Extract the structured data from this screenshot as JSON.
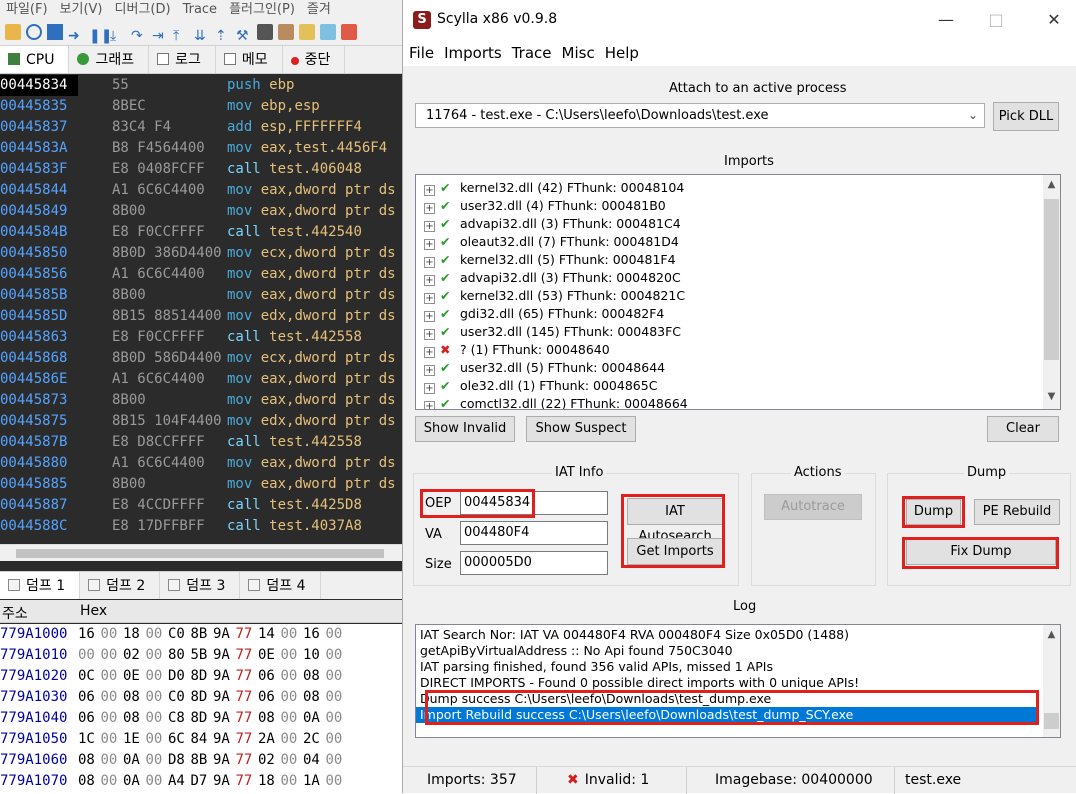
{
  "debugger": {
    "menu": [
      "파일(F)",
      "보기(V)",
      "디버그(D)",
      "Trace",
      "플러그인(P)",
      "즐겨"
    ],
    "tabs": [
      "CPU",
      "그래프",
      "로그",
      "메모",
      "중단"
    ],
    "code_rows": [
      {
        "addr": "00445834",
        "bytes": "55",
        "mn": "push",
        "ops": "ebp"
      },
      {
        "addr": "00445835",
        "bytes": "8BEC",
        "mn": "mov",
        "ops": "ebp,esp"
      },
      {
        "addr": "00445837",
        "bytes": "83C4 F4",
        "mn": "add",
        "ops": "esp,FFFFFFF4"
      },
      {
        "addr": "0044583A",
        "bytes": "B8 F4564400",
        "mn": "mov",
        "ops": "eax,test.4456F4"
      },
      {
        "addr": "0044583F",
        "bytes": "E8 0408FCFF",
        "mn": "call",
        "ops": "test.406048"
      },
      {
        "addr": "00445844",
        "bytes": "A1 6C6C4400",
        "mn": "mov",
        "ops": "eax,dword ptr ds"
      },
      {
        "addr": "00445849",
        "bytes": "8B00",
        "mn": "mov",
        "ops": "eax,dword ptr ds"
      },
      {
        "addr": "0044584B",
        "bytes": "E8 F0CCFFFF",
        "mn": "call",
        "ops": "test.442540"
      },
      {
        "addr": "00445850",
        "bytes": "8B0D 386D4400",
        "mn": "mov",
        "ops": "ecx,dword ptr ds"
      },
      {
        "addr": "00445856",
        "bytes": "A1 6C6C4400",
        "mn": "mov",
        "ops": "eax,dword ptr ds"
      },
      {
        "addr": "0044585B",
        "bytes": "8B00",
        "mn": "mov",
        "ops": "eax,dword ptr ds"
      },
      {
        "addr": "0044585D",
        "bytes": "8B15 88514400",
        "mn": "mov",
        "ops": "edx,dword ptr ds"
      },
      {
        "addr": "00445863",
        "bytes": "E8 F0CCFFFF",
        "mn": "call",
        "ops": "test.442558"
      },
      {
        "addr": "00445868",
        "bytes": "8B0D 586D4400",
        "mn": "mov",
        "ops": "ecx,dword ptr ds"
      },
      {
        "addr": "0044586E",
        "bytes": "A1 6C6C4400",
        "mn": "mov",
        "ops": "eax,dword ptr ds"
      },
      {
        "addr": "00445873",
        "bytes": "8B00",
        "mn": "mov",
        "ops": "eax,dword ptr ds"
      },
      {
        "addr": "00445875",
        "bytes": "8B15 104F4400",
        "mn": "mov",
        "ops": "edx,dword ptr ds"
      },
      {
        "addr": "0044587B",
        "bytes": "E8 D8CCFFFF",
        "mn": "call",
        "ops": "test.442558"
      },
      {
        "addr": "00445880",
        "bytes": "A1 6C6C4400",
        "mn": "mov",
        "ops": "eax,dword ptr ds"
      },
      {
        "addr": "00445885",
        "bytes": "8B00",
        "mn": "mov",
        "ops": "eax,dword ptr ds"
      },
      {
        "addr": "00445887",
        "bytes": "E8 4CCDFFFF",
        "mn": "call",
        "ops": "test.4425D8"
      },
      {
        "addr": "0044588C",
        "bytes": "E8 17DFFBFF",
        "mn": "call",
        "ops": "test.4037A8"
      }
    ],
    "dump_tabs": [
      "덤프 1",
      "덤프 2",
      "덤프 3",
      "덤프 4"
    ],
    "dump_header": {
      "addr": "주소",
      "hex": "Hex"
    },
    "dump_rows": [
      {
        "addr": "779A1000",
        "bytes": [
          "16",
          "00",
          "18",
          "00",
          "C0",
          "8B",
          "9A",
          "77",
          "14",
          "00",
          "16",
          "00"
        ]
      },
      {
        "addr": "779A1010",
        "bytes": [
          "00",
          "00",
          "02",
          "00",
          "80",
          "5B",
          "9A",
          "77",
          "0E",
          "00",
          "10",
          "00"
        ]
      },
      {
        "addr": "779A1020",
        "bytes": [
          "0C",
          "00",
          "0E",
          "00",
          "D0",
          "8D",
          "9A",
          "77",
          "06",
          "00",
          "08",
          "00"
        ]
      },
      {
        "addr": "779A1030",
        "bytes": [
          "06",
          "00",
          "08",
          "00",
          "C0",
          "8D",
          "9A",
          "77",
          "06",
          "00",
          "08",
          "00"
        ]
      },
      {
        "addr": "779A1040",
        "bytes": [
          "06",
          "00",
          "08",
          "00",
          "C8",
          "8D",
          "9A",
          "77",
          "08",
          "00",
          "0A",
          "00"
        ]
      },
      {
        "addr": "779A1050",
        "bytes": [
          "1C",
          "00",
          "1E",
          "00",
          "6C",
          "84",
          "9A",
          "77",
          "2A",
          "00",
          "2C",
          "00"
        ]
      },
      {
        "addr": "779A1060",
        "bytes": [
          "08",
          "00",
          "0A",
          "00",
          "D8",
          "8B",
          "9A",
          "77",
          "02",
          "00",
          "04",
          "00"
        ]
      },
      {
        "addr": "779A1070",
        "bytes": [
          "08",
          "00",
          "0A",
          "00",
          "A4",
          "D7",
          "9A",
          "77",
          "18",
          "00",
          "1A",
          "00"
        ]
      }
    ]
  },
  "scylla": {
    "title": "Scylla x86 v0.9.8",
    "menu": [
      "File",
      "Imports",
      "Trace",
      "Misc",
      "Help"
    ],
    "attach": {
      "label": "Attach to an active process",
      "process": "11764 - test.exe - C:\\Users\\leefo\\Downloads\\test.exe",
      "pick_dll": "Pick DLL"
    },
    "imports": {
      "label": "Imports",
      "items": [
        {
          "text": "kernel32.dll (42) FThunk: 00048104",
          "status": "ok"
        },
        {
          "text": "user32.dll (4) FThunk: 000481B0",
          "status": "ok"
        },
        {
          "text": "advapi32.dll (3) FThunk: 000481C4",
          "status": "ok"
        },
        {
          "text": "oleaut32.dll (7) FThunk: 000481D4",
          "status": "ok"
        },
        {
          "text": "kernel32.dll (5) FThunk: 000481F4",
          "status": "ok"
        },
        {
          "text": "advapi32.dll (3) FThunk: 0004820C",
          "status": "ok"
        },
        {
          "text": "kernel32.dll (53) FThunk: 0004821C",
          "status": "ok"
        },
        {
          "text": "gdi32.dll (65) FThunk: 000482F4",
          "status": "ok"
        },
        {
          "text": "user32.dll (145) FThunk: 000483FC",
          "status": "ok"
        },
        {
          "text": "? (1) FThunk: 00048640",
          "status": "invalid"
        },
        {
          "text": "user32.dll (5) FThunk: 00048644",
          "status": "ok"
        },
        {
          "text": "ole32.dll (1) FThunk: 0004865C",
          "status": "ok"
        },
        {
          "text": "comctl32.dll (22) FThunk: 00048664",
          "status": "ok"
        }
      ],
      "show_invalid": "Show Invalid",
      "show_suspect": "Show Suspect",
      "clear": "Clear"
    },
    "iat_info": {
      "label": "IAT Info",
      "oep_label": "OEP",
      "oep": "00445834",
      "va_label": "VA",
      "va": "004480F4",
      "size_label": "Size",
      "size": "000005D0",
      "autosearch": "IAT Autosearch",
      "get_imports": "Get Imports"
    },
    "actions": {
      "label": "Actions",
      "autotrace": "Autotrace"
    },
    "dump": {
      "label": "Dump",
      "dump": "Dump",
      "pe_rebuild": "PE Rebuild",
      "fix_dump": "Fix Dump"
    },
    "log": {
      "label": "Log",
      "lines": [
        "IAT Search Nor: IAT VA 004480F4 RVA 000480F4 Size 0x05D0 (1488)",
        "getApiByVirtualAddress :: No Api found 750C3040",
        "IAT parsing finished, found 356 valid APIs, missed 1 APIs",
        "DIRECT IMPORTS - Found 0 possible direct imports with 0 unique APIs!",
        "Dump success C:\\Users\\leefo\\Downloads\\test_dump.exe",
        "Import Rebuild success C:\\Users\\leefo\\Downloads\\test_dump_SCY.exe"
      ]
    },
    "status": {
      "imports": "Imports: 357",
      "invalid": "Invalid: 1",
      "imagebase": "Imagebase: 00400000",
      "module": "test.exe"
    },
    "colors": {
      "highlight_box": "#e0201c",
      "selection": "#0078d7",
      "ok": "#2a9a2a",
      "invalid": "#d42020"
    }
  }
}
